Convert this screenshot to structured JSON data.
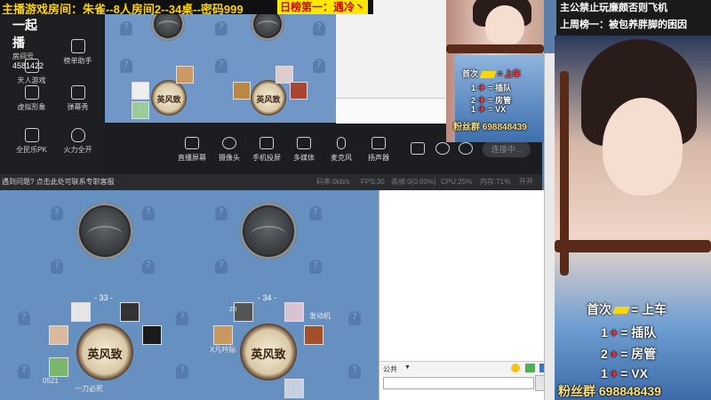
{
  "banner": {
    "main": "主播游戏房间：朱雀--8人房间2--34桌--密码999",
    "highlight": "日榜第一：遇冷丶"
  },
  "logo": {
    "title": "一起播",
    "room_label": "房间号",
    "room_id": "4581422"
  },
  "menu": {
    "items": [
      {
        "label": "天人游戏",
        "icon": "game-icon"
      },
      {
        "label": "榜单助手",
        "icon": "ranking-icon"
      },
      {
        "label": "虚拟形象",
        "icon": "avatar-icon"
      },
      {
        "label": "弹幕秀",
        "icon": "danmaku-icon"
      },
      {
        "label": "全民乐PK",
        "icon": "pk-icon"
      },
      {
        "label": "火力全开",
        "icon": "fire-icon"
      }
    ]
  },
  "toolbar": {
    "items": [
      {
        "label": "直播屏幕",
        "icon": "screen-icon"
      },
      {
        "label": "摄像头",
        "icon": "camera-icon"
      },
      {
        "label": "手机投屏",
        "icon": "phone-cast-icon"
      },
      {
        "label": "多媒体",
        "icon": "media-icon"
      },
      {
        "label": "麦克风",
        "icon": "mic-icon"
      },
      {
        "label": "扬声器",
        "icon": "speaker-icon"
      }
    ],
    "connect": "连接中..."
  },
  "status": {
    "hint": "遇到问题? 点击此处可联系专职客服",
    "rate": "码率:0kb/s",
    "fps": "FPS:30",
    "drop": "丢帧:0(0.00%)",
    "cpu": "CPU:25%",
    "mem": "内存:71%",
    "tip": "开开"
  },
  "tables": {
    "top_label": "公共",
    "t33": "- 33 -",
    "t34": "- 34 -",
    "players": [
      "zh",
      "发动机",
      "X凡吟际",
      "0521",
      "一刀必死"
    ],
    "badge_text": "英风致"
  },
  "chat": {
    "channel": "公共"
  },
  "notice": {
    "line1": "主公禁止玩廉颇否则飞机",
    "line2": "上周榜一：被包养胖脚的困因"
  },
  "overlay": {
    "row1_a": "首次",
    "row1_b": "= 上车",
    "row2_n": "1",
    "row2_b": "= 插队",
    "row3_n": "2",
    "row3_b": "= 房管",
    "row4_n": "1",
    "row4_b": "= VX",
    "fans": "粉丝群 698848439"
  }
}
